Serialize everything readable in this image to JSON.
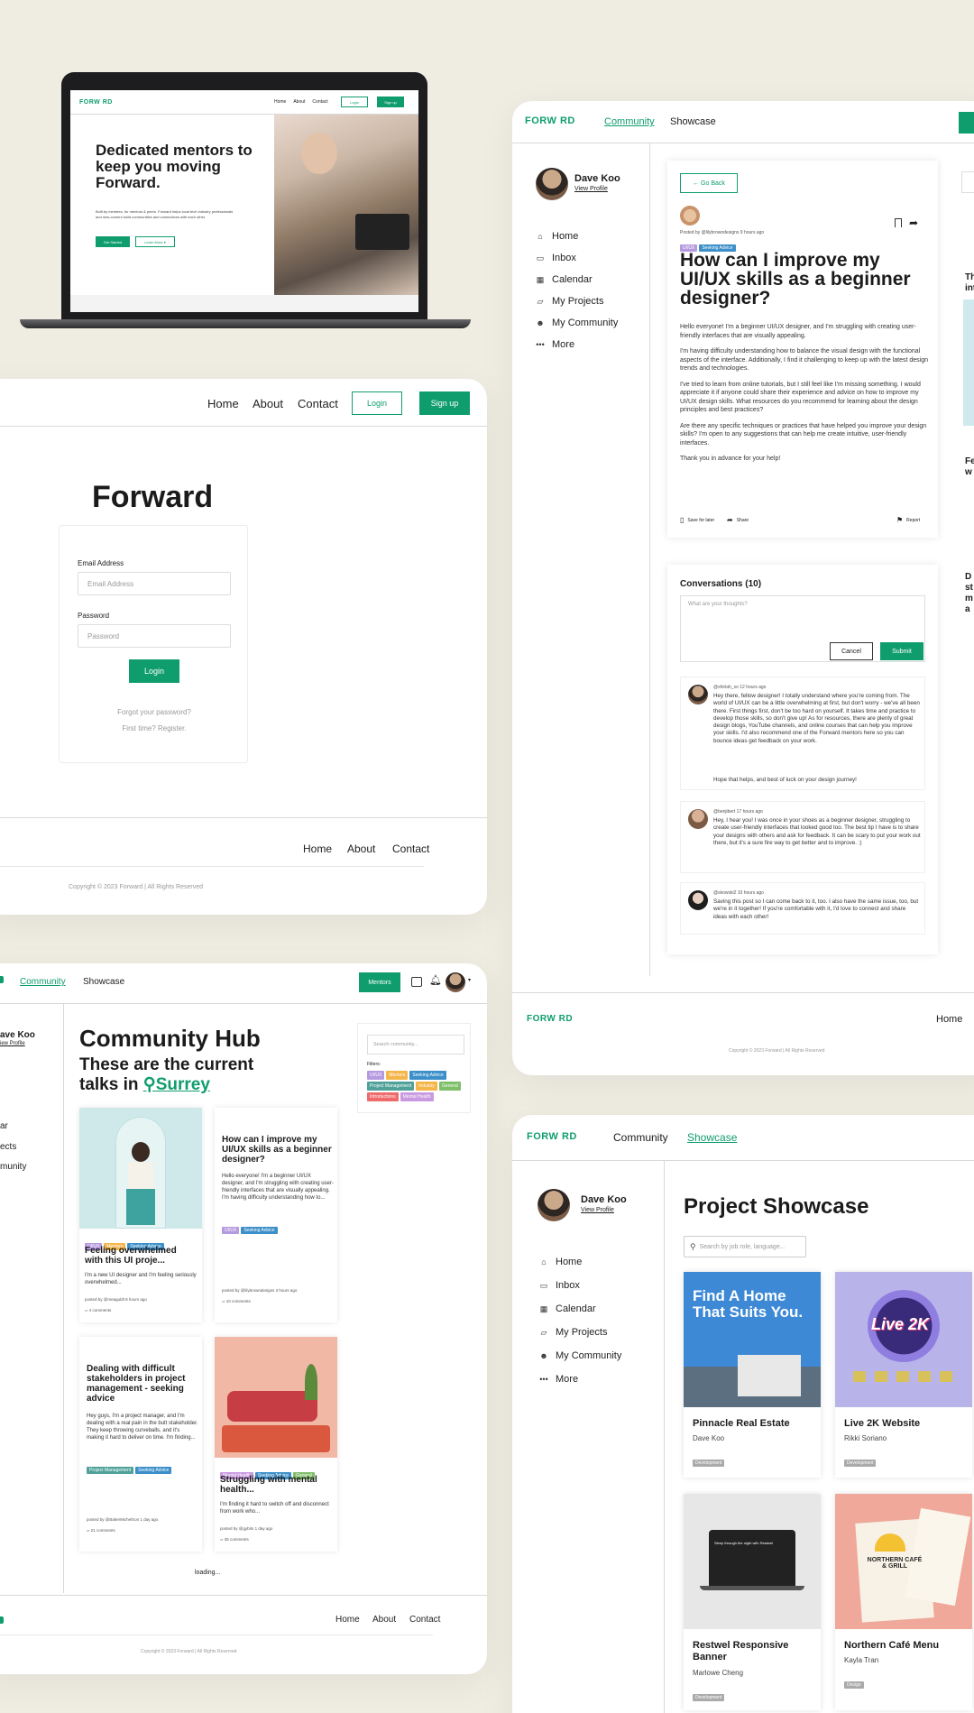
{
  "brand": {
    "logo": "FORW RD",
    "green": "#0f9d6e",
    "bg": "#efede2"
  },
  "laptop": {
    "nav": [
      "Home",
      "About",
      "Contact"
    ],
    "login": "Login",
    "signup": "Sign up",
    "headline": "Dedicated mentors to keep you moving Forward.",
    "body": "Built by mentees, for mentors & peers. Forward helps local tech industry professionals and new-comers build communities and connections with each other.",
    "cta": "Get Started",
    "learn": "Learn More ▾"
  },
  "login_page": {
    "nav": [
      "Home",
      "About",
      "Contact"
    ],
    "login_btn": "Login",
    "signup_btn": "Sign up",
    "title": "Forward",
    "email_label": "Email Address",
    "email_placeholder": "Email Address",
    "password_label": "Password",
    "password_placeholder": "Password",
    "submit": "Login",
    "forgot": "Forgot your password?",
    "register": "First time? Register.",
    "footer_nav": [
      "Home",
      "About",
      "Contact"
    ],
    "copyright": "Copyright © 2023 Forward | All Rights Reserved"
  },
  "post_page": {
    "nav": {
      "community": "Community",
      "showcase": "Showcase"
    },
    "user": {
      "name": "Dave Koo",
      "link": "View Profile"
    },
    "sidebar": [
      {
        "icon": "home-icon",
        "glyph": "⌂",
        "label": "Home"
      },
      {
        "icon": "inbox-icon",
        "glyph": "▭",
        "label": "Inbox"
      },
      {
        "icon": "calendar-icon",
        "glyph": "▦",
        "label": "Calendar"
      },
      {
        "icon": "folder-icon",
        "glyph": "▱",
        "label": "My Projects"
      },
      {
        "icon": "community-icon",
        "glyph": "☻",
        "label": "My Community"
      },
      {
        "icon": "more-icon",
        "glyph": "•••",
        "label": "More"
      }
    ],
    "back": "← Go Back",
    "posted": "Posted by @lilybrowndesigns 9 hours ago",
    "tags": [
      {
        "label": "UI/UX",
        "color": "#b69ae0"
      },
      {
        "label": "Seeking Advice",
        "color": "#3c8fc9"
      }
    ],
    "title": "How can I improve my UI/UX skills as a beginner designer?",
    "paragraphs": [
      "Hello everyone! I'm a beginner UI/UX designer, and I'm struggling with creating user-friendly interfaces that are visually appealing.",
      "I'm having difficulty understanding how to balance the visual design with the functional aspects of the interface. Additionally, I find it challenging to keep up with the latest design trends and technologies.",
      "I've tried to learn from online tutorials, but I still feel like I'm missing something. I would appreciate it if anyone could share their experience and advice on how to improve my UI/UX design skills. What resources do you recommend for learning about the design principles and best practices?",
      "Are there any specific techniques or practices that have helped you improve your design skills? I'm open to any suggestions that can help me create intuitive, user-friendly interfaces.",
      "Thank you in advance for your help!"
    ],
    "save": "Save for later",
    "share": "Share",
    "report": "Report",
    "conversations": "Conversations (10)",
    "thoughts_placeholder": "What are your thoughts?",
    "cancel": "Cancel",
    "submit": "Submit",
    "comments": [
      {
        "meta": "@shiriah_xo 12 hours ago",
        "text": "Hey there, fellow designer! I totally understand where you're coming from. The world of UI/UX can be a little overwhelming at first, but don't worry - we've all been there. First things first, don't be too hard on yourself. It takes time and practice to develop those skills, so don't give up! As for resources, there are plenty of great design blogs, YouTube channels, and online courses that can help you improve your skills. I'd also recommend one of the Forward mentors here so you can bounce ideas get feedback on your work.",
        "text2": "Hope that helps, and best of luck on your design journey!"
      },
      {
        "meta": "@benjibert 17 hours ago",
        "text": "Hey, I hear you! I was once in your shoes as a beginner designer, struggling to create user-friendly interfaces that looked good too. The best tip I have is to share your designs with others and ask for feedback. It can be scary to put your work out there, but it's a sure fire way to get better and to improve. :)",
        "text2": ""
      },
      {
        "meta": "@skowski2 10 hours ago",
        "text": "Saving this post so I can come back to it, too. I also have the same issue, too, but we're in it together! If you're comfortable with it, I'd love to connect and share ideas with each other!",
        "text2": ""
      }
    ],
    "right_peek": [
      "Thr",
      "int",
      "Fe",
      "w",
      "D",
      "st",
      "m",
      "a"
    ],
    "footer_home": "Home",
    "copyright": "Copyright © 2023 Forward | All Rights Reserved"
  },
  "hub": {
    "nav": {
      "community": "Community",
      "showcase": "Showcase"
    },
    "mentors": "Mentors",
    "user_frag": {
      "name": "ave Koo",
      "link": "iew Profile"
    },
    "side_frag": [
      "ar",
      "ects",
      "munity"
    ],
    "title": "Community Hub",
    "subtitle1": "These are the current",
    "subtitle2": "talks in",
    "location": "Surrey",
    "search_placeholder": "Search community...",
    "filters_label": "Filters:",
    "filters": [
      {
        "label": "UI/UX",
        "color": "#b69ae0"
      },
      {
        "label": "Mentors",
        "color": "#f4b54a"
      },
      {
        "label": "Seeking Advice",
        "color": "#3c8fc9"
      },
      {
        "label": "Project Management",
        "color": "#4fa19a"
      },
      {
        "label": "Industry",
        "color": "#f4b54a"
      },
      {
        "label": "General",
        "color": "#7fbf6a"
      },
      {
        "label": "Introductions",
        "color": "#ef6a6a"
      },
      {
        "label": "Mental Health",
        "color": "#c99ae0"
      }
    ],
    "posts": [
      {
        "title": "Feeling overwhelmed with this UI proje...",
        "body": "I'm a new UI designer and I'm feeling seriously overwhelmed...",
        "meta": "posted by @meaguldt 8 hours ago",
        "comments": "4 comments",
        "tags": [
          {
            "label": "UI/UX",
            "color": "#b69ae0"
          },
          {
            "label": "Mentors",
            "color": "#f4b54a"
          },
          {
            "label": "Seeking Advice",
            "color": "#3c8fc9"
          }
        ]
      },
      {
        "title": "How can I improve my UI/UX skills as a beginner designer?",
        "body": "Hello everyone! I'm a beginner UI/UX designer, and I'm struggling with creating user-friendly interfaces that are visually appealing. I'm having difficulty understanding how to...",
        "meta": "posted by @lilybrowndesigns 3 hours ago",
        "comments": "10 comments",
        "tags": [
          {
            "label": "UI/UX",
            "color": "#b69ae0"
          },
          {
            "label": "Seeking Advice",
            "color": "#3c8fc9"
          }
        ]
      },
      {
        "title": "Dealing with difficult stakeholders in project management - seeking advice",
        "body": "Hey guys, I'm a project manager, and I'm dealing with a real pain in the butt stakeholder. They keep throwing curveballs, and it's making it hard to deliver on time. I'm finding...",
        "meta": "posted by @BakerMichelSon 1 day ago",
        "comments": "21 comments",
        "tags": [
          {
            "label": "Project Management",
            "color": "#4fa19a"
          },
          {
            "label": "Seeking Advice",
            "color": "#3c8fc9"
          }
        ]
      },
      {
        "title": "Struggling with mental health...",
        "body": "I'm finding it hard to switch off and disconnect from work who...",
        "meta": "posted by @gybitn 1 day ago",
        "comments": "35 comments",
        "tags": [
          {
            "label": "Mental Health",
            "color": "#c99ae0"
          },
          {
            "label": "Seeking Advice",
            "color": "#3c8fc9"
          },
          {
            "label": "General",
            "color": "#7fbf6a"
          }
        ]
      }
    ],
    "loading": "loading...",
    "footer_nav": [
      "Home",
      "About",
      "Contact"
    ],
    "copyright": "Copyright © 2023 Forward | All Rights Reserved"
  },
  "showcase": {
    "nav": {
      "community": "Community",
      "showcase": "Showcase"
    },
    "user": {
      "name": "Dave Koo",
      "link": "View Profile"
    },
    "sidebar": [
      {
        "icon": "home-icon",
        "glyph": "⌂",
        "label": "Home"
      },
      {
        "icon": "inbox-icon",
        "glyph": "▭",
        "label": "Inbox"
      },
      {
        "icon": "calendar-icon",
        "glyph": "▦",
        "label": "Calendar"
      },
      {
        "icon": "folder-icon",
        "glyph": "▱",
        "label": "My Projects"
      },
      {
        "icon": "community-icon",
        "glyph": "☻",
        "label": "My Community"
      },
      {
        "icon": "more-icon",
        "glyph": "•••",
        "label": "More"
      }
    ],
    "title": "Project Showcase",
    "search_placeholder": "Search by job role, language...",
    "projects": [
      {
        "title": "Pinnacle Real Estate",
        "author": "Dave Koo",
        "tag": "Development",
        "thumb_text": "Find A Home That Suits You."
      },
      {
        "title": "Live 2K Website",
        "author": "Rikki Soriano",
        "tag": "Development",
        "thumb_text": "Live 2K"
      },
      {
        "title": "Restwel Responsive Banner",
        "author": "Marlowe Cheng",
        "tag": "Development",
        "thumb_text": "Sleep through the night with Restwel"
      },
      {
        "title": "Northern Café Menu",
        "author": "Kayla Tran",
        "tag": "Design",
        "thumb_text": "NORTHERN CAFÉ & GRILL"
      }
    ]
  }
}
